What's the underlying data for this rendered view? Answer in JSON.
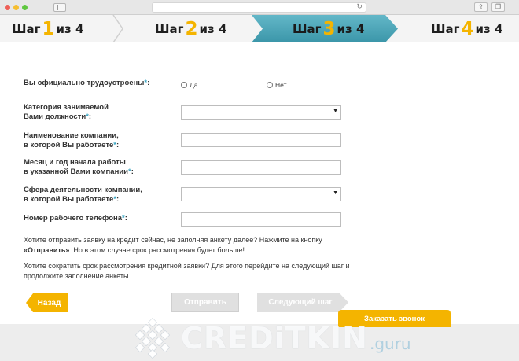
{
  "steps": [
    {
      "prefix": "Шаг",
      "num": "1",
      "suffix": "из 4",
      "active": false
    },
    {
      "prefix": "Шаг",
      "num": "2",
      "suffix": "из 4",
      "active": false
    },
    {
      "prefix": "Шаг",
      "num": "3",
      "suffix": "из 4",
      "active": true
    },
    {
      "prefix": "Шаг",
      "num": "4",
      "suffix": "из 4",
      "active": false
    }
  ],
  "form": {
    "employed_label": "Вы официально трудоустроены",
    "employed_options": [
      "Да",
      "Нет"
    ],
    "position_label_l1": "Категория занимаемой",
    "position_label_l2": "Вами должности",
    "company_label_l1": "Наименование компании,",
    "company_label_l2": "в которой Вы работаете",
    "start_label_l1": "Месяц и год начала работы",
    "start_label_l2": "в указанной Вами компании",
    "sphere_label_l1": "Сфера деятельности компании,",
    "sphere_label_l2": "в которой Вы работаете",
    "phone_label": "Номер рабочего телефона",
    "required_mark": "*",
    "colon": ":"
  },
  "info": {
    "p1_a": "Хотите отправить заявку на кредит сейчас, не заполняя анкету далее? Нажмите на кнопку",
    "p1_bold": "«Отправить»",
    "p1_b": ". Но в этом случае срок рассмотрения будет больше!",
    "p2": "Хотите сократить срок рассмотрения кредитной заявки? Для этого перейдите на следующий шаг и продолжите заполнение анкеты."
  },
  "buttons": {
    "back": "Назад",
    "send": "Отправить",
    "next": "Следующий шаг",
    "call": "Заказать звонок"
  },
  "watermark": {
    "brand": "CREDiTKIN",
    "suffix": ".guru"
  },
  "colors": {
    "accent_yellow": "#f4b400",
    "active_step": "#4aa6b8",
    "required": "#3aa6c4"
  }
}
